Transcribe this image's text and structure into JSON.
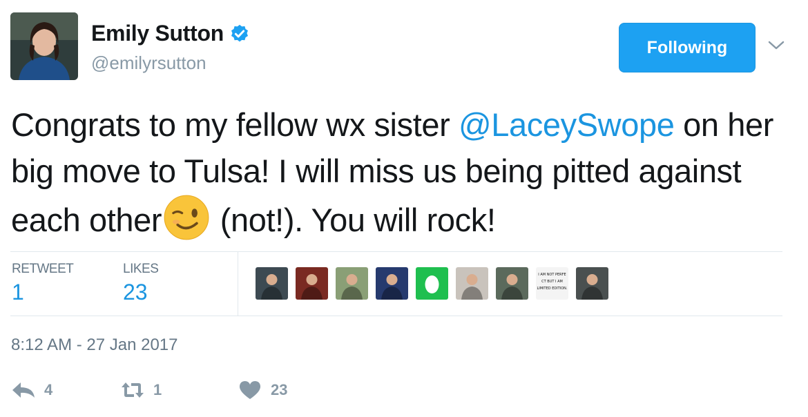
{
  "user": {
    "name": "Emily Sutton",
    "handle": "@emilyrsutton"
  },
  "follow_button": {
    "label": "Following"
  },
  "tweet": {
    "text_part1": "Congrats to my fellow wx sister ",
    "mention": "@LaceySwope",
    "text_part2": " on her big move to Tulsa! I will miss us being pitted against each other",
    "text_part3": " (not!). You will rock!",
    "emoji": "winking-face"
  },
  "stats": {
    "retweets_label": "RETWEET",
    "retweets_value": "1",
    "likes_label": "LIKES",
    "likes_value": "23"
  },
  "likers": [
    {
      "name": "liker-1",
      "color": "#3d4a52"
    },
    {
      "name": "liker-2",
      "color": "#7a2a22"
    },
    {
      "name": "liker-3",
      "color": "#8a9f76"
    },
    {
      "name": "liker-4",
      "color": "#263a6e"
    },
    {
      "name": "liker-5",
      "color": "#1fbf4f"
    },
    {
      "name": "liker-6",
      "color": "#c9c3bc"
    },
    {
      "name": "liker-7",
      "color": "#5b6a5c"
    },
    {
      "name": "liker-8",
      "color": "#f4f4f4"
    },
    {
      "name": "liker-9",
      "color": "#4a5050"
    }
  ],
  "liker8_text": "I AM NOT PERFECT BUT I AM LIMITED EDITION.",
  "timestamp": "8:12 AM - 27 Jan 2017",
  "actions": {
    "reply_count": "4",
    "retweet_count": "1",
    "like_count": "23"
  },
  "colors": {
    "accent": "#1da1f2",
    "link": "#1b95e0",
    "muted": "#8899a6"
  }
}
